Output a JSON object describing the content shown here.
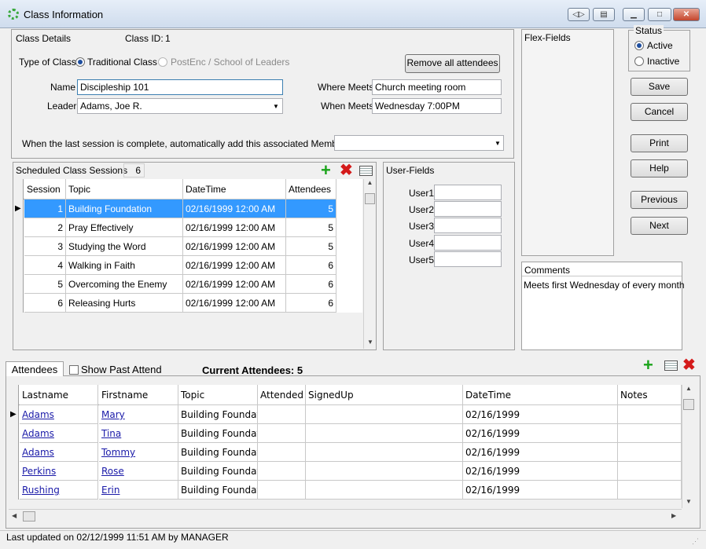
{
  "window": {
    "title": "Class Information",
    "btn_nav": "◁▷",
    "btn_export": "▤",
    "btn_min": "▁",
    "btn_max": "□",
    "btn_close": "✕"
  },
  "details": {
    "header": "Class Details",
    "class_id_label": "Class ID:",
    "class_id": "1",
    "type_label": "Type of Class:",
    "type_opt1": "Traditional Class",
    "type_opt2": "PostEnc / School of Leaders",
    "remove_btn": "Remove all attendees",
    "name_label": "Name",
    "name_value": "Discipleship 101",
    "leader_label": "Leader",
    "leader_value": "Adams, Joe R.",
    "where_label": "Where Meets",
    "where_value": "Church meeting room",
    "when_label": "When Meets",
    "when_value": "Wednesday 7:00PM",
    "member_step_label": "When the last session is complete, automatically add this associated Member Step",
    "member_step_value": ""
  },
  "flex_fields_label": "Flex-Fields",
  "status": {
    "label": "Status",
    "active": "Active",
    "inactive": "Inactive"
  },
  "buttons": {
    "save": "Save",
    "cancel": "Cancel",
    "print": "Print",
    "help": "Help",
    "previous": "Previous",
    "next": "Next"
  },
  "sessions": {
    "label": "Scheduled Class Sessions",
    "count": "6",
    "columns": [
      "Session",
      "Topic",
      "DateTime",
      "Attendees"
    ],
    "rows": [
      [
        "1",
        "Building Foundation",
        "02/16/1999 12:00 AM",
        "5"
      ],
      [
        "2",
        "Pray Effectively",
        "02/16/1999 12:00 AM",
        "5"
      ],
      [
        "3",
        "Studying the Word",
        "02/16/1999 12:00 AM",
        "5"
      ],
      [
        "4",
        "Walking in Faith",
        "02/16/1999 12:00 AM",
        "6"
      ],
      [
        "5",
        "Overcoming the Enemy",
        "02/16/1999 12:00 AM",
        "6"
      ],
      [
        "6",
        "Releasing Hurts",
        "02/16/1999 12:00 AM",
        "6"
      ]
    ]
  },
  "user_fields": {
    "label": "User-Fields",
    "items": [
      "User1",
      "User2",
      "User3",
      "User4",
      "User5"
    ]
  },
  "comments": {
    "label": "Comments",
    "text": "Meets first Wednesday of every month"
  },
  "attendees": {
    "tab": "Attendees",
    "show_past": "Show Past Attend",
    "current": "Current Attendees: 5",
    "columns": [
      "Lastname",
      "Firstname",
      "Topic",
      "Attended",
      "SignedUp",
      "DateTime",
      "Notes"
    ],
    "rows": [
      [
        "Adams",
        "Mary",
        "Building Foundati",
        "",
        "",
        "02/16/1999",
        ""
      ],
      [
        "Adams",
        "Tina",
        "Building Foundati",
        "",
        "",
        "02/16/1999",
        ""
      ],
      [
        "Adams",
        "Tommy",
        "Building Foundati",
        "",
        "",
        "02/16/1999",
        ""
      ],
      [
        "Perkins",
        "Rose",
        "Building Foundati",
        "",
        "",
        "02/16/1999",
        ""
      ],
      [
        "Rushing",
        "Erin",
        "Building Foundati",
        "",
        "",
        "02/16/1999",
        ""
      ]
    ]
  },
  "status_bar": "Last updated on 02/12/1999 11:51 AM by MANAGER",
  "colors": {
    "selection": "#3399ff",
    "link": "#1a1aa8",
    "add": "#1ba41b",
    "delete": "#d41a1a"
  }
}
